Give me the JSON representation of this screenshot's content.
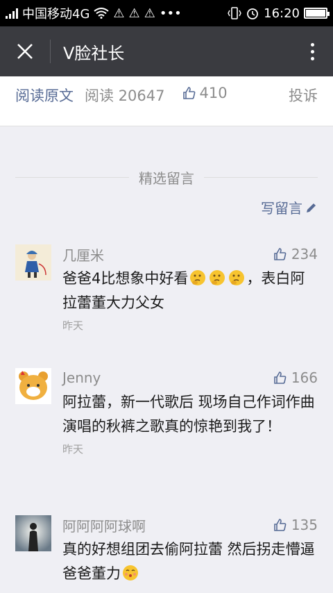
{
  "status_bar": {
    "carrier": "中国移动4G",
    "time": "16:20",
    "icons": [
      "signal-icon",
      "wifi-icon",
      "warning-icon",
      "warning-icon",
      "warning-icon",
      "more-dots-icon",
      "vibrate-icon",
      "alarm-icon",
      "battery-icon"
    ]
  },
  "title_bar": {
    "title": "V脸社长",
    "close_icon": "close-icon",
    "more_icon": "more-vertical-icon"
  },
  "article_footer": {
    "read_original": "阅读原文",
    "read_count": "阅读 20647",
    "like_count": "410",
    "complain": "投诉"
  },
  "comments_section": {
    "title": "精选留言",
    "write_label": "写留言"
  },
  "comments": [
    {
      "nickname": "几厘米",
      "likes": "234",
      "text_1": "爸爸4比想象中好看",
      "text_2": "，表白阿拉蕾董大力父女",
      "time": "昨天",
      "emojis": [
        "thinking-emoji",
        "thinking-emoji",
        "thinking-emoji"
      ]
    },
    {
      "nickname": "Jenny",
      "likes": "166",
      "text": "阿拉蕾，新一代歌后 现场自己作词作曲演唱的秋裤之歌真的惊艳到我了！",
      "time": "昨天"
    },
    {
      "nickname": "阿阿阿阿球啊",
      "likes": "135",
      "text": "真的好想组团去偷阿拉蕾 然后拐走懵逼爸爸董力",
      "emojis": [
        "kissing-emoji"
      ]
    }
  ],
  "colors": {
    "title_bar_bg": "#3a3b40",
    "link_blue": "#576b95",
    "page_bg": "#efeff4"
  }
}
